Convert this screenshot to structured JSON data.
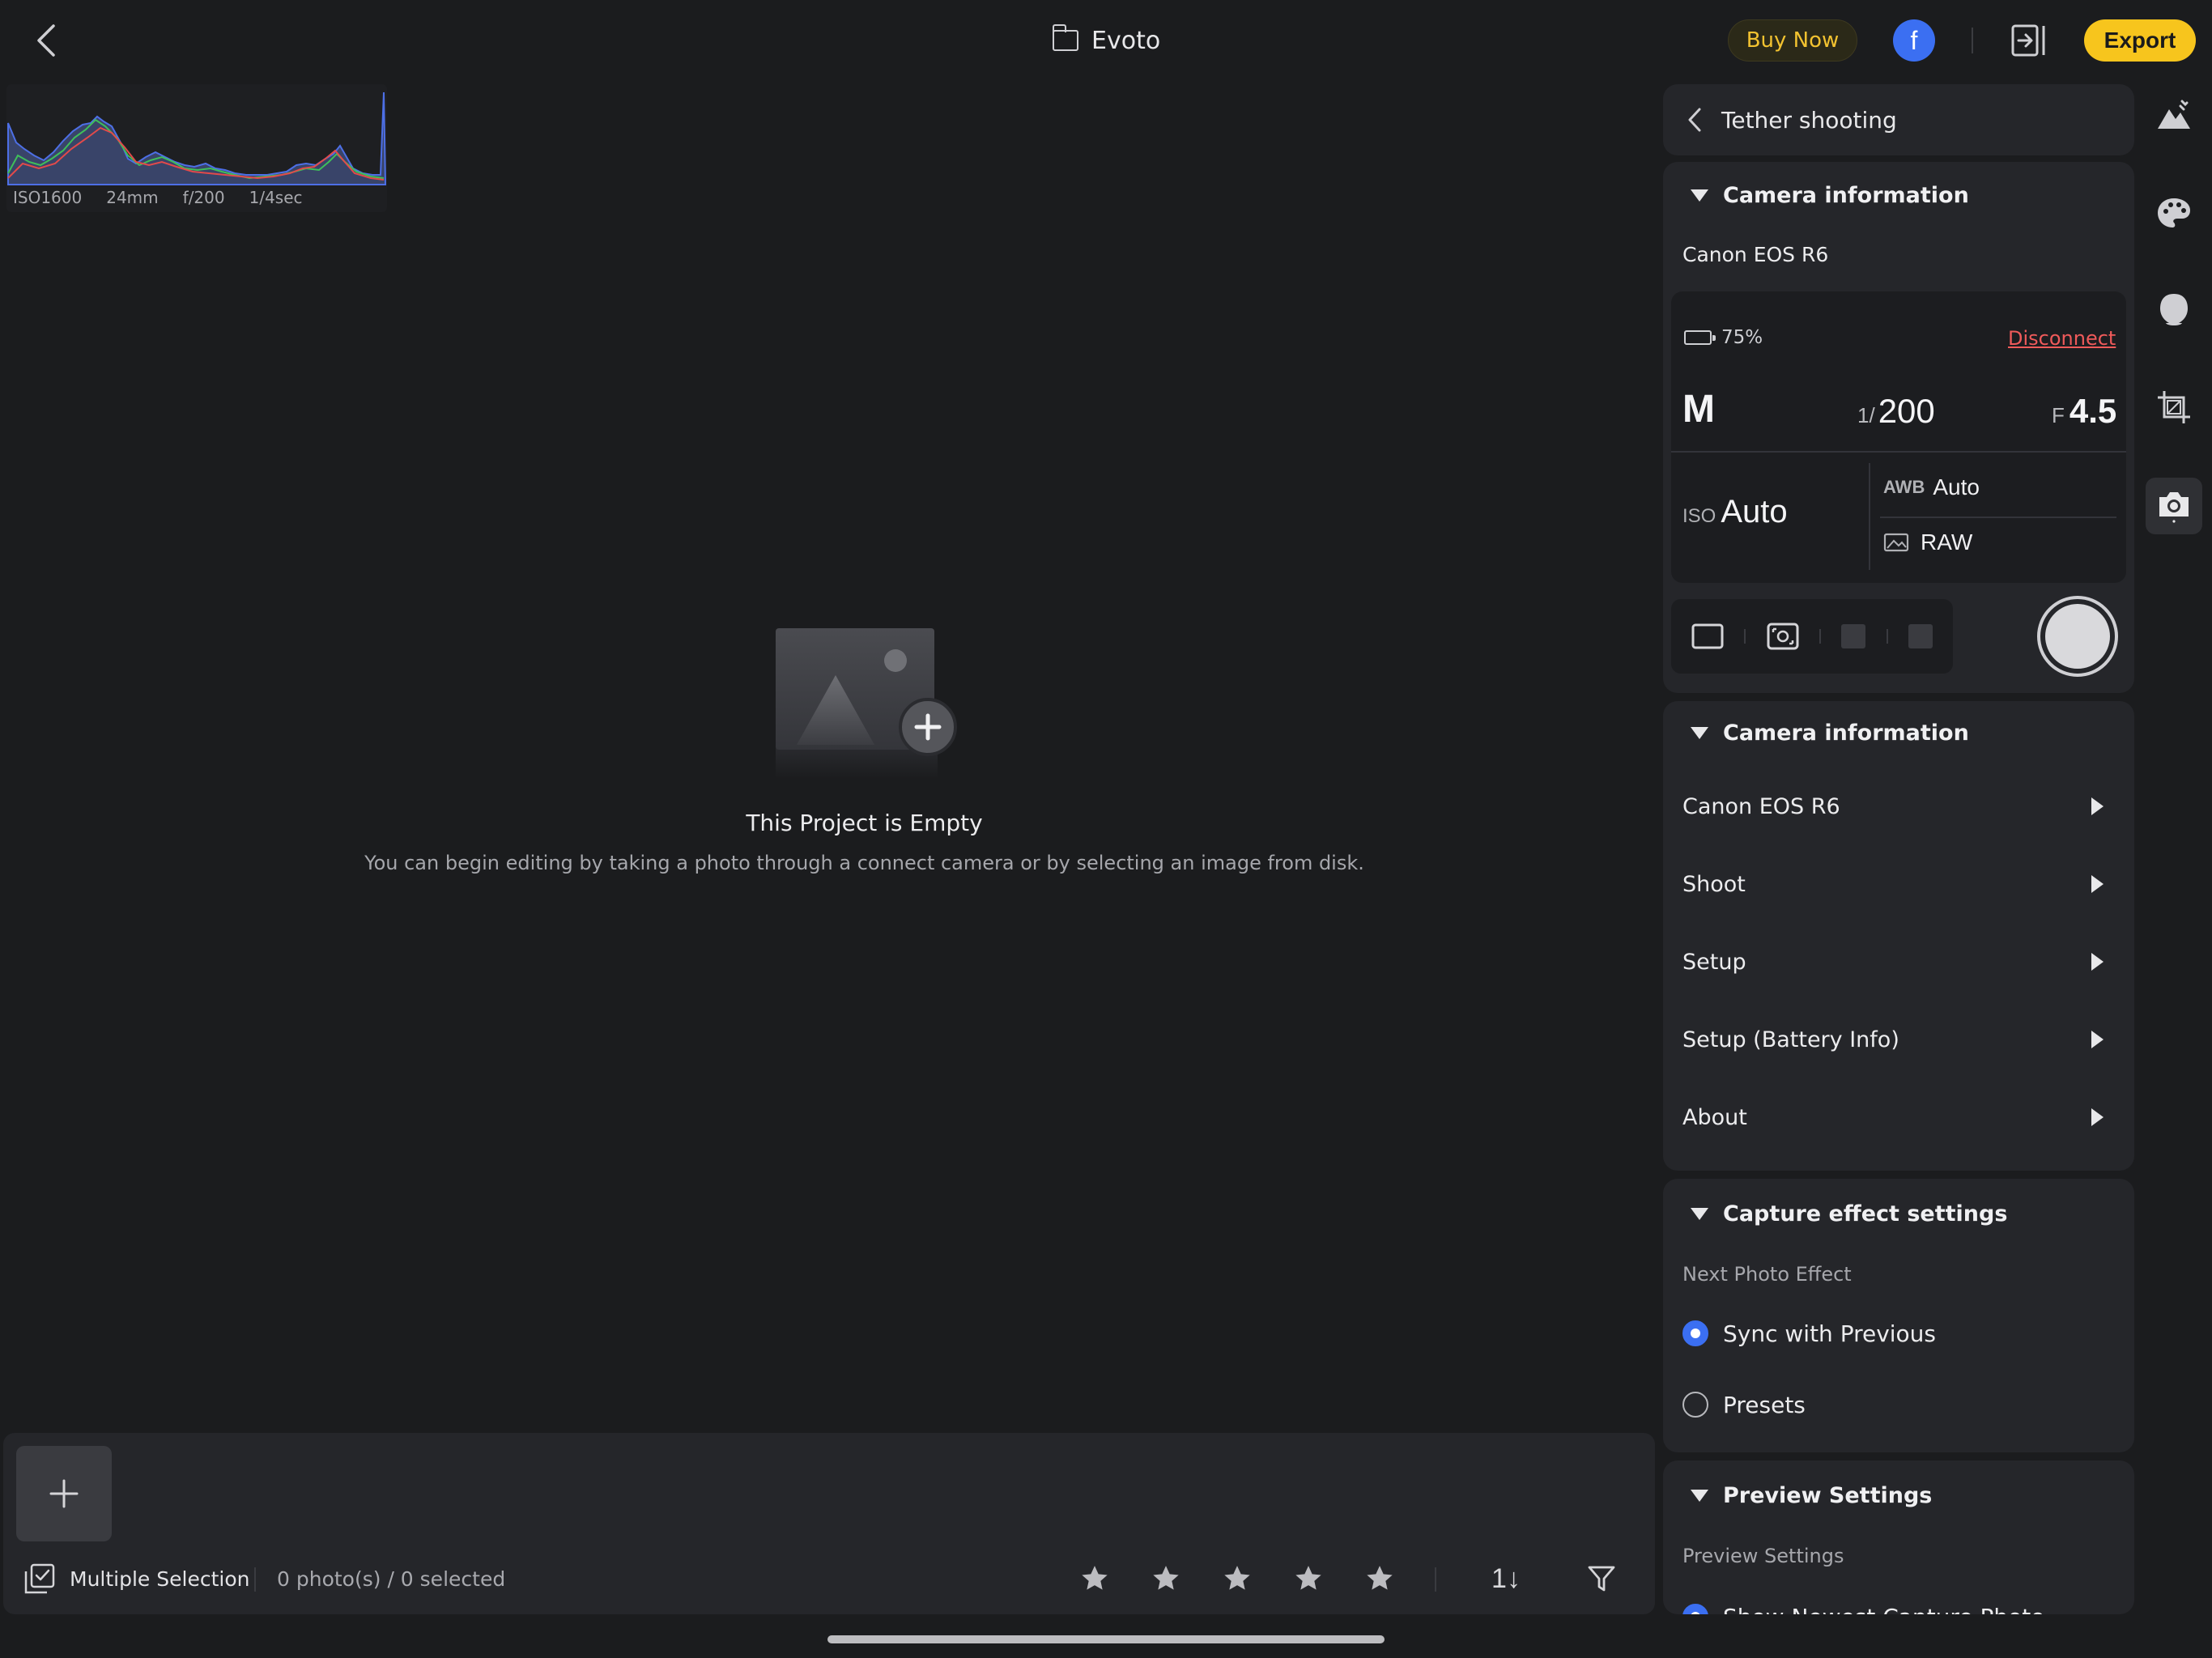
{
  "topbar": {
    "project_title": "Evoto",
    "buy_now": "Buy Now",
    "avatar_letter": "f",
    "export": "Export"
  },
  "histogram": {
    "exif": [
      "ISO1600",
      "24mm",
      "f/200",
      "1/4sec"
    ]
  },
  "empty_state": {
    "title": "This Project is Empty",
    "description": "You can begin editing by taking a photo through a connect camera or by selecting an image from disk."
  },
  "filmstrip": {
    "multiple_selection": "Multiple Selection",
    "photo_count": "0 photo(s) / 0 selected",
    "sort_label": "1↓"
  },
  "panel": {
    "header": "Tether shooting",
    "camera_card": {
      "title": "Camera information",
      "model": "Canon EOS R6",
      "battery": "75%",
      "battery_fraction": 0.75,
      "disconnect": "Disconnect",
      "mode": "M",
      "shutter_prefix": "1/",
      "shutter_value": "200",
      "aperture_prefix": "F",
      "aperture_value": "4.5",
      "iso_prefix": "ISO",
      "iso_value": "Auto",
      "wb_prefix": "AWB",
      "wb_value": "Auto",
      "format_value": "RAW"
    },
    "camera_info": {
      "title": "Camera information",
      "items": [
        "Canon EOS R6",
        "Shoot",
        "Setup",
        "Setup (Battery Info)",
        "About"
      ]
    },
    "capture_effect": {
      "title": "Capture effect settings",
      "subtitle": "Next Photo Effect",
      "options": [
        "Sync with Previous",
        "Presets"
      ],
      "selected": "Sync with Previous"
    },
    "preview": {
      "title": "Preview Settings",
      "subtitle": "Preview Settings",
      "option": "Show Newest Capture Photo"
    }
  },
  "colors": {
    "accent_yellow": "#f7c51d",
    "accent_blue": "#3b6ff2",
    "danger_red": "#ef5a5a",
    "panel_bg": "#25262a",
    "app_bg": "#1b1c1e"
  }
}
